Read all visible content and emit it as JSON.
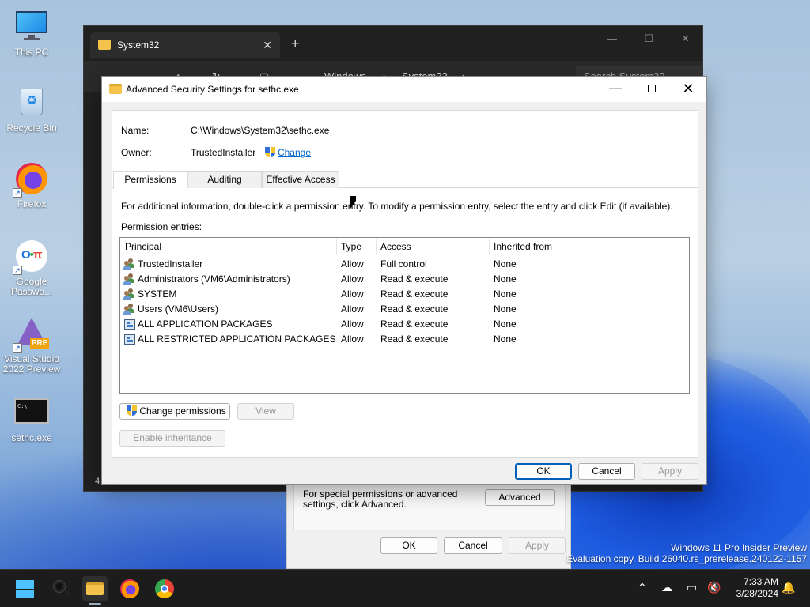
{
  "desktop": {
    "icons": [
      {
        "label": "This PC"
      },
      {
        "label": "Recycle Bin"
      },
      {
        "label": "Firefox"
      },
      {
        "label": "Google Passwo..."
      },
      {
        "label": "Visual Studio 2022 Preview",
        "badge": "PRE"
      },
      {
        "label": "sethc.exe",
        "console_text": "C:\\_"
      }
    ],
    "watermark": {
      "line1": "Windows 11 Pro Insider Preview",
      "line2": "Evaluation copy. Build 26040.rs_prerelease.240122-1157"
    }
  },
  "explorer": {
    "tab_title": "System32",
    "tab_close": "✕",
    "new_tab": "+",
    "breadcrumb": [
      "Windows",
      "System32"
    ],
    "search_placeholder": "Search System32",
    "status": "4"
  },
  "properties": {
    "advanced_text": "For special permissions or advanced settings, click Advanced.",
    "advanced_button": "Advanced",
    "ok": "OK",
    "cancel": "Cancel",
    "apply": "Apply"
  },
  "dialog": {
    "title": "Advanced Security Settings for sethc.exe",
    "name_label": "Name:",
    "name_value": "C:\\Windows\\System32\\sethc.exe",
    "owner_label": "Owner:",
    "owner_value": "TrustedInstaller",
    "change_link": "Change",
    "tabs": [
      {
        "label": "Permissions",
        "active": true
      },
      {
        "label": "Auditing",
        "active": false
      },
      {
        "label": "Effective Access",
        "active": false
      }
    ],
    "info_text": "For additional information, double-click a permission entry. To modify a permission entry, select the entry and click Edit (if available).",
    "entries_label": "Permission entries:",
    "columns": [
      "Principal",
      "Type",
      "Access",
      "Inherited from"
    ],
    "rows": [
      {
        "principal": "TrustedInstaller",
        "type": "Allow",
        "access": "Full control",
        "inherited": "None",
        "icon": "user-group-icon"
      },
      {
        "principal": "Administrators (VM6\\Administrators)",
        "type": "Allow",
        "access": "Read & execute",
        "inherited": "None",
        "icon": "user-group-icon"
      },
      {
        "principal": "SYSTEM",
        "type": "Allow",
        "access": "Read & execute",
        "inherited": "None",
        "icon": "user-group-icon"
      },
      {
        "principal": "Users (VM6\\Users)",
        "type": "Allow",
        "access": "Read & execute",
        "inherited": "None",
        "icon": "user-group-icon"
      },
      {
        "principal": "ALL APPLICATION PACKAGES",
        "type": "Allow",
        "access": "Read & execute",
        "inherited": "None",
        "icon": "package-icon"
      },
      {
        "principal": "ALL RESTRICTED APPLICATION PACKAGES",
        "type": "Allow",
        "access": "Read & execute",
        "inherited": "None",
        "icon": "package-icon"
      }
    ],
    "change_permissions_button": "Change permissions",
    "view_button": "View",
    "enable_inheritance_button": "Enable inheritance",
    "ok": "OK",
    "cancel": "Cancel",
    "apply": "Apply"
  },
  "taskbar": {
    "time": "7:33 AM",
    "date": "3/28/2024",
    "pinned": [
      "start-icon",
      "search-icon",
      "file-explorer-icon",
      "firefox-icon",
      "chrome-icon"
    ]
  },
  "colors": {
    "accent": "#005fb8",
    "link": "#0066cc",
    "taskbar": "#1c1c1c"
  }
}
